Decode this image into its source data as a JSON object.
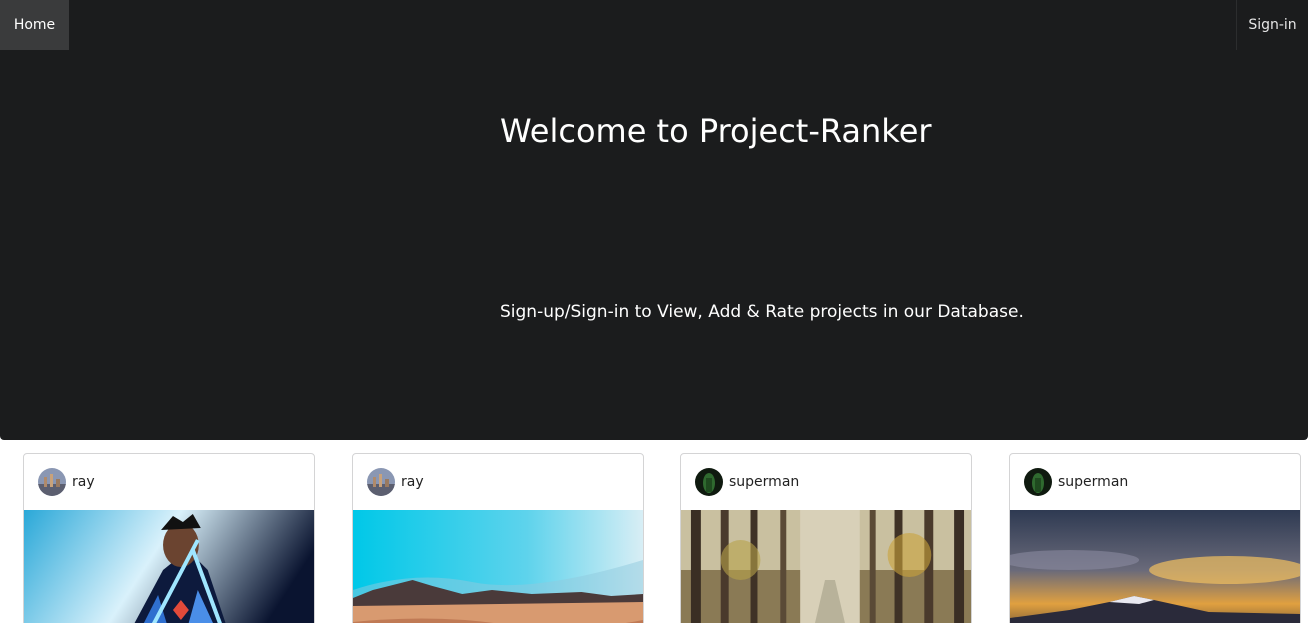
{
  "nav": {
    "home_label": "Home",
    "signin_label": "Sign-in"
  },
  "hero": {
    "title": "Welcome to Project-Ranker",
    "subtitle": "Sign-up/Sign-in to View, Add & Rate projects in our Database."
  },
  "cards": [
    {
      "username": "ray"
    },
    {
      "username": "ray"
    },
    {
      "username": "superman"
    },
    {
      "username": "superman"
    }
  ]
}
